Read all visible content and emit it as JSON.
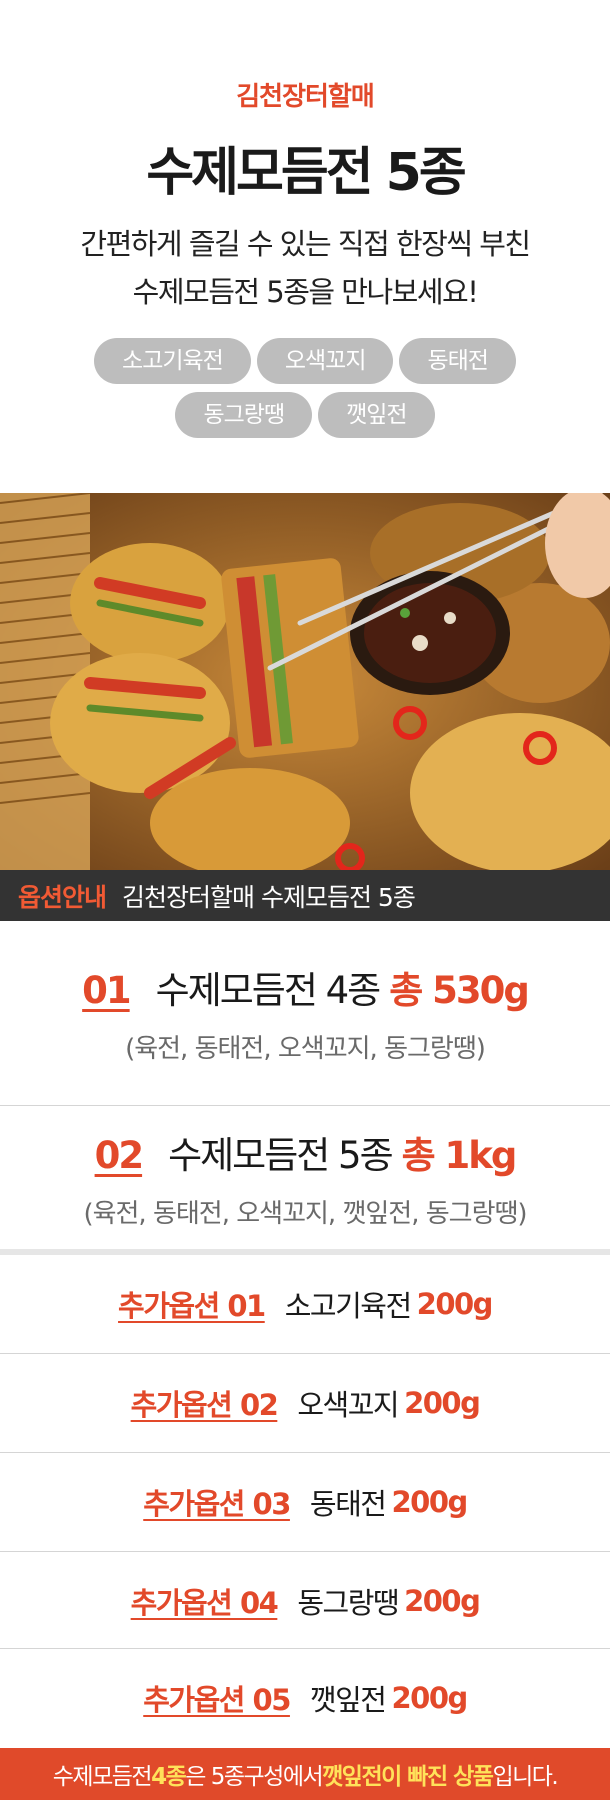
{
  "header": {
    "brand": "김천장터할매",
    "title": "수제모듬전 5종",
    "desc_line1": "간편하게 즐길 수 있는 직접 한장씩 부친",
    "desc_line2": "수제모듬전 5종을 만나보세요!"
  },
  "chips": [
    "소고기육전",
    "오색꼬지",
    "동태전",
    "동그랑땡",
    "깻잎전"
  ],
  "option_bar": {
    "tag": "옵션안내",
    "text": "김천장터할매 수제모듬전 5종"
  },
  "plans": [
    {
      "num": "01",
      "name": "수제모듬전 4종",
      "amount": "총 530g",
      "sub": "(육전, 동태전, 오색꼬지, 동그랑땡)"
    },
    {
      "num": "02",
      "name": "수제모듬전 5종",
      "amount": "총 1kg",
      "sub": "(육전, 동태전, 오색꼬지, 깻잎전, 동그랑땡)"
    }
  ],
  "addons": [
    {
      "label": "추가옵션 01",
      "name": "소고기육전",
      "weight": "200g"
    },
    {
      "label": "추가옵션 02",
      "name": "오색꼬지",
      "weight": "200g"
    },
    {
      "label": "추가옵션 03",
      "name": "동태전",
      "weight": "200g"
    },
    {
      "label": "추가옵션 04",
      "name": "동그랑땡",
      "weight": "200g"
    },
    {
      "label": "추가옵션 05",
      "name": "깻잎전",
      "weight": "200g"
    }
  ],
  "footer": {
    "p1": "수제모듬전 ",
    "p2": "4종",
    "p3": "은 5종구성에서 ",
    "p4": "깻잎전이 빠진 상품",
    "p5": "입니다."
  },
  "colors": {
    "accent": "#e2492a",
    "chip_bg": "#bdbdbd",
    "bar_bg": "#333333",
    "footer_bg": "#e04a2a",
    "footer_highlight": "#ffe25a"
  }
}
